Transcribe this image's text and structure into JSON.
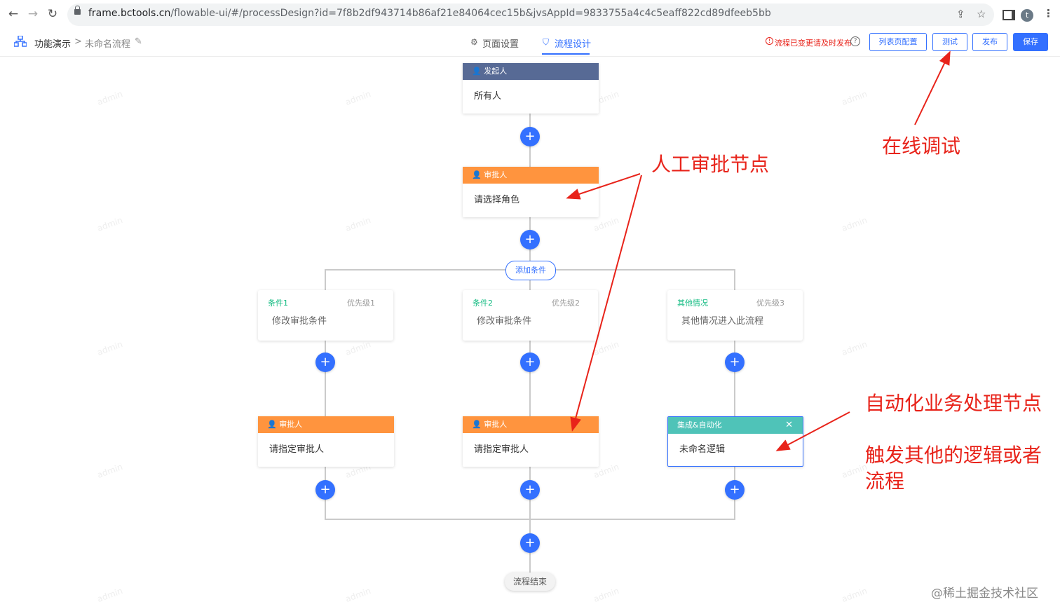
{
  "browser": {
    "url_host": "frame.bctools.cn",
    "url_path": "/flowable-ui/#/processDesign?id=7f8b2df943714b86af21e84064cec15b&jvsAppId=9833755a4c4c5eaff822cd89dfeeb5bb",
    "avatar_letter": "t"
  },
  "header": {
    "breadcrumb_root": "功能演示",
    "breadcrumb_sep": ">",
    "process_name": "未命名流程",
    "tabs": [
      {
        "label": "页面设置",
        "icon": "gear-icon",
        "active": false
      },
      {
        "label": "流程设计",
        "icon": "flow-icon",
        "active": true
      }
    ],
    "warning": "流程已变更请及时发布",
    "buttons": {
      "list_config": "列表页配置",
      "test": "测试",
      "publish": "发布",
      "save": "保存"
    }
  },
  "flow": {
    "start": {
      "title": "发起人",
      "body": "所有人"
    },
    "approver": {
      "title": "审批人",
      "body": "请选择角色"
    },
    "add_condition": "添加条件",
    "conditions": [
      {
        "name": "条件1",
        "priority": "优先级1",
        "desc": "修改审批条件"
      },
      {
        "name": "条件2",
        "priority": "优先级2",
        "desc": "修改审批条件"
      },
      {
        "name": "其他情况",
        "priority": "优先级3",
        "desc": "其他情况进入此流程"
      }
    ],
    "branch_nodes": [
      {
        "title": "审批人",
        "body": "请指定审批人"
      },
      {
        "title": "审批人",
        "body": "请指定审批人"
      },
      {
        "title": "集成&自动化",
        "body": "未命名逻辑"
      }
    ],
    "end": "流程结束",
    "plus_symbol": "+",
    "colors": {
      "start": "#576a95",
      "approver": "#ff943e",
      "automation": "#4fc3b8",
      "accent": "#3370ff"
    }
  },
  "annotations": {
    "manual_node": "人工审批节点",
    "online_debug": "在线调试",
    "auto_node": "自动化业务处理节点",
    "trigger_line1": "触发其他的逻辑或者",
    "trigger_line2": "流程"
  },
  "watermark": {
    "user": "admin",
    "site": "@稀土掘金技术社区"
  }
}
